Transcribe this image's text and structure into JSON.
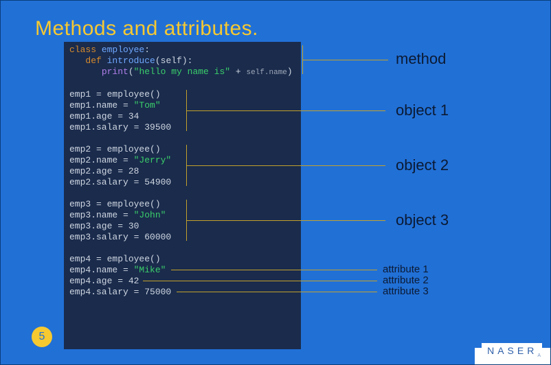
{
  "title": "Methods and attributes.",
  "page_number": "5",
  "brand": "NASER",
  "labels": {
    "method": "method",
    "object1": "object 1",
    "object2": "object 2",
    "object3": "object 3",
    "attr1": "attribute 1",
    "attr2": "attribute 2",
    "attr3": "attribute 3"
  },
  "code": {
    "l1_kw": "class",
    "l1_cls": "employee",
    "l1_colon": ":",
    "l2_kw": "def",
    "l2_fn": "introduce",
    "l2_args": "(self):",
    "l3_call": "print",
    "l3_open": "(",
    "l3_str": "\"hello my name is\"",
    "l3_plus": " + ",
    "l3_self": "self.name",
    "l3_close": ")",
    "e1a": "emp1 = employee()",
    "e1b_pre": "emp1.name = ",
    "e1b_str": "\"Tom\"",
    "e1c": "emp1.age = 34",
    "e1d": "emp1.salary = 39500",
    "e2a": "emp2 = employee()",
    "e2b_pre": "emp2.name = ",
    "e2b_str": "\"Jerry\"",
    "e2c": "emp2.age = 28",
    "e2d": "emp2.salary = 54900",
    "e3a": "emp3 = employee()",
    "e3b_pre": "emp3.name = ",
    "e3b_str": "\"John\"",
    "e3c": "emp3.age = 30",
    "e3d": "emp3.salary = 60000",
    "e4a": "emp4 = employee()",
    "e4b_pre": "emp4.name = ",
    "e4b_str": "\"Mike\"",
    "e4c": "emp4.age = 42",
    "e4d": "emp4.salary = 75000"
  }
}
